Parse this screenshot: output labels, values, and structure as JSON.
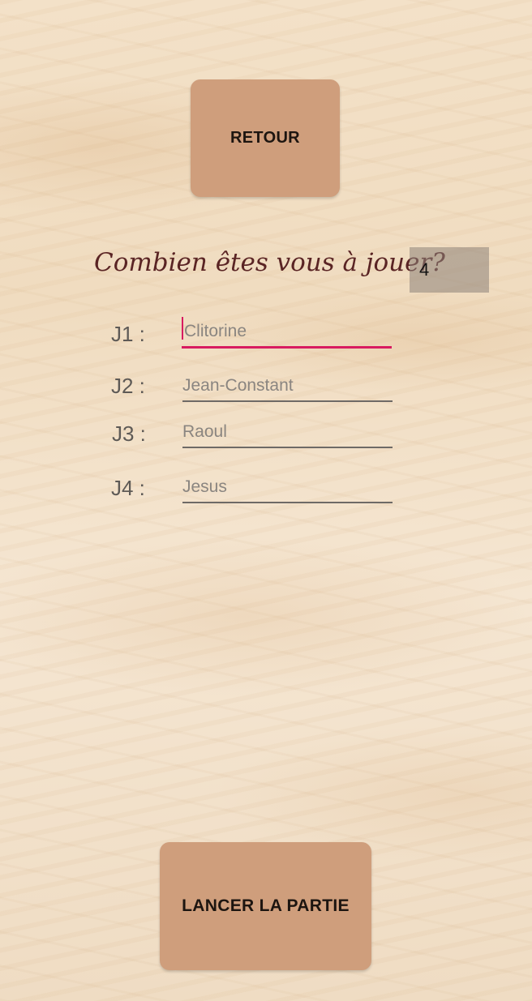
{
  "buttons": {
    "back_label": "RETOUR",
    "start_label": "LANCER LA PARTIE"
  },
  "question": {
    "text": "Combien êtes vous à jouer?"
  },
  "player_count": {
    "value": "4"
  },
  "players": [
    {
      "label": "J1 :",
      "placeholder": "Clitorine",
      "focused": true
    },
    {
      "label": "J2 :",
      "placeholder": "Jean-Constant",
      "focused": false
    },
    {
      "label": "J3 :",
      "placeholder": "Raoul",
      "focused": false
    },
    {
      "label": "J4 :",
      "placeholder": "Jesus",
      "focused": false
    }
  ],
  "colors": {
    "button_bg": "#cf9e7c",
    "question_text": "#5a2424",
    "focus_underline": "#d81b60",
    "count_box_bg": "#9a8f86"
  }
}
